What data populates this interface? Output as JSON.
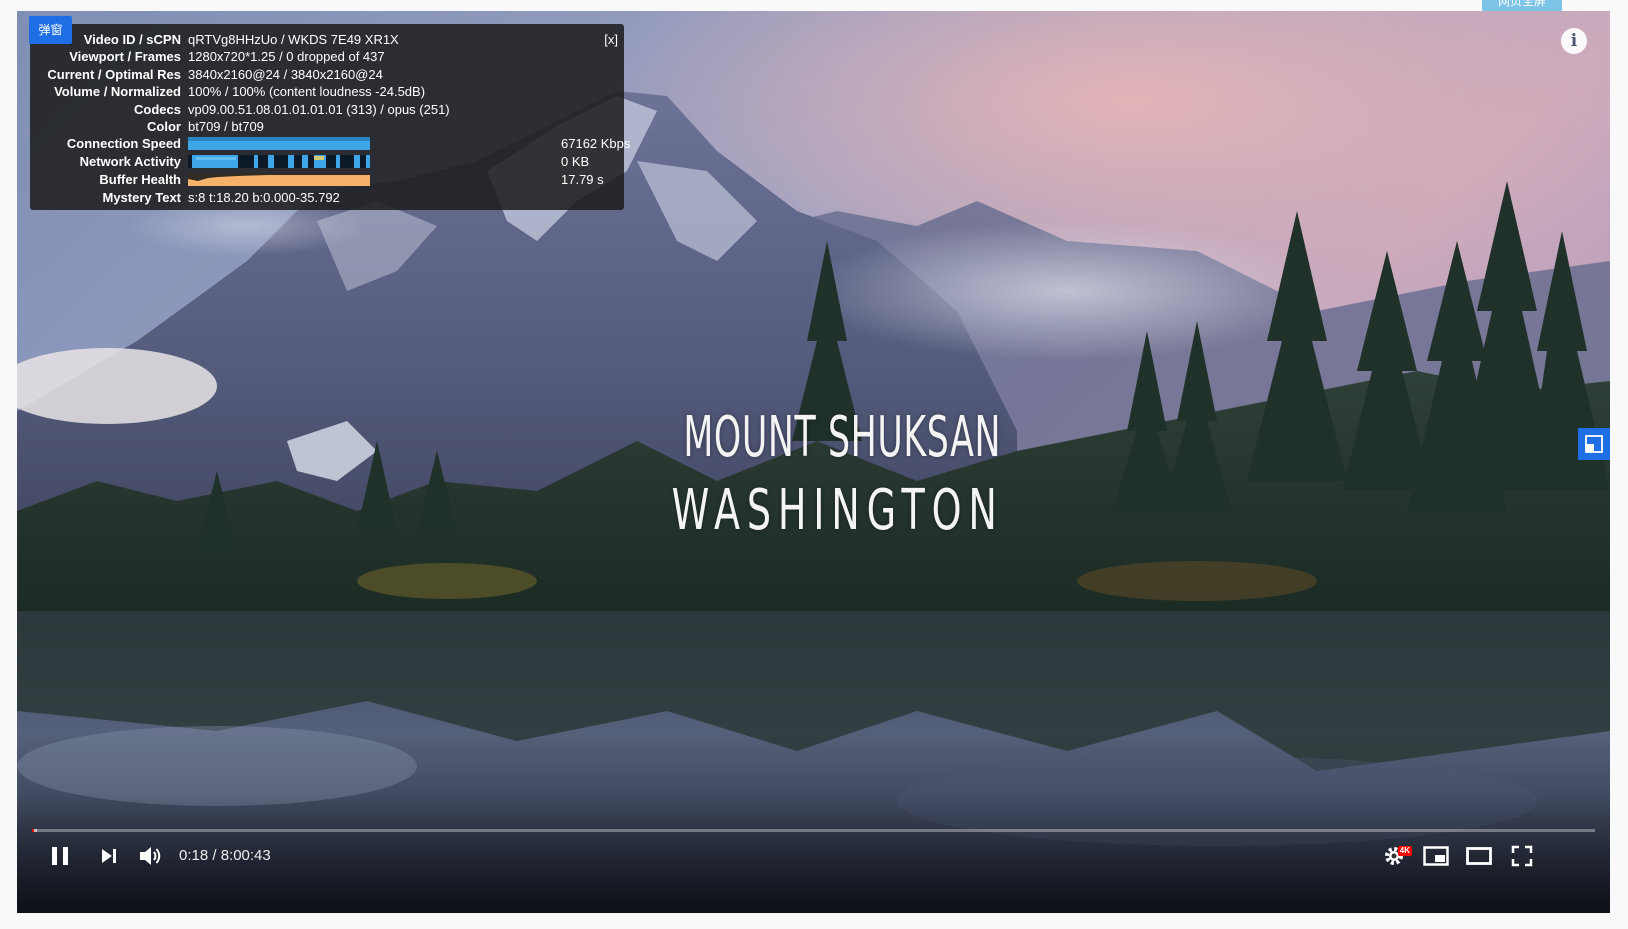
{
  "page": {
    "fullscreen_tab_label": "网页全屏"
  },
  "video": {
    "title_line_1": "MOUNT SHUKSAN",
    "title_line_2": "WASHINGTON"
  },
  "stats": {
    "popup_badge": "弹窗",
    "close_label": "[x]",
    "rows": [
      {
        "label": "Video ID / sCPN",
        "value": "qRTVg8HHzUo / WKDS 7E49 XR1X"
      },
      {
        "label": "Viewport / Frames",
        "value": "1280x720*1.25 / 0 dropped of 437"
      },
      {
        "label": "Current / Optimal Res",
        "value": "3840x2160@24 / 3840x2160@24"
      },
      {
        "label": "Volume / Normalized",
        "value": "100% / 100% (content loudness -24.5dB)"
      },
      {
        "label": "Codecs",
        "value": "vp09.00.51.08.01.01.01.01 (313) / opus (251)"
      },
      {
        "label": "Color",
        "value": "bt709 / bt709"
      }
    ],
    "graphs": [
      {
        "label": "Connection Speed",
        "value": "67162 Kbps",
        "color": "#3ea6e6"
      },
      {
        "label": "Network Activity",
        "value": "0 KB",
        "color": "#3ea6e6"
      },
      {
        "label": "Buffer Health",
        "value": "17.79 s",
        "color": "#f6b26b"
      }
    ],
    "mystery": {
      "label": "Mystery Text",
      "value": "s:8 t:18.20 b:0.000-35.792"
    }
  },
  "controls": {
    "current_time": "0:18",
    "duration": "8:00:43",
    "time_text": "0:18 / 8:00:43",
    "progress_played": 0.0006,
    "progress_buffered": 0.0012,
    "hd_badge": "4K",
    "accent_color": "#ff0000",
    "icons": [
      "pause-icon",
      "next-icon",
      "volume-icon",
      "settings-icon",
      "miniplayer-icon",
      "theater-icon",
      "fullscreen-icon"
    ]
  }
}
